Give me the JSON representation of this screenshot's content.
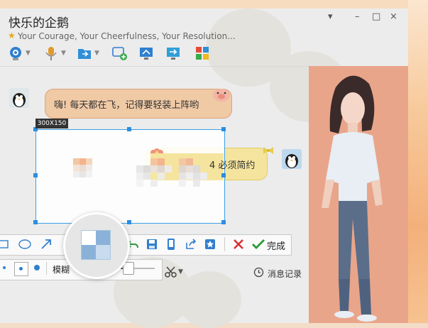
{
  "window": {
    "title": "快乐的企鹅",
    "subtitle": "Your Courage, Your Cheerfulness, Your Resolution..."
  },
  "window_controls": [
    "▾",
    "–",
    "□",
    "×"
  ],
  "toolbar_top_icons": [
    "webcam-icon",
    "microphone-icon",
    "file-transfer-icon",
    "remote-assist-icon",
    "screen-share-icon",
    "screen-present-icon",
    "apps-grid-icon"
  ],
  "chat": {
    "left_message": "嗨! 每天都在飞，记得要轻装上阵哟",
    "right_message": "4 必须简约"
  },
  "selection": {
    "size_label": "300X150"
  },
  "edit_toolbar": {
    "icons": [
      "rectangle-icon",
      "ellipse-icon",
      "arrow-icon",
      "undo-icon",
      "save-icon",
      "phone-icon",
      "share-icon",
      "favorite-icon",
      "cancel-icon",
      "confirm-icon"
    ],
    "done_label": "完成"
  },
  "sub_toolbar": {
    "blur_label": "模糊",
    "blur_level": 0.2
  },
  "history_label": "消息记录",
  "colors": {
    "selection_border": "#3aa0e8",
    "bubble_left": "#f0c9a5",
    "bubble_right": "#f5e49e",
    "confirm_green": "#2c9a3c",
    "cancel_red": "#d93030"
  }
}
